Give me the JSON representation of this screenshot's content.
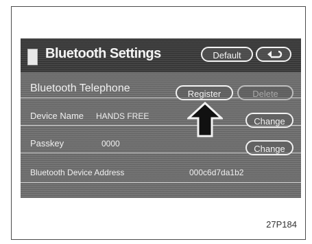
{
  "header": {
    "title": "Bluetooth Settings",
    "default_label": "Default",
    "back_icon": "return-arrow-icon"
  },
  "telephone": {
    "label": "Bluetooth Telephone",
    "register_label": "Register",
    "delete_label": "Delete"
  },
  "device_name": {
    "label": "Device Name",
    "value": "HANDS FREE",
    "change_label": "Change"
  },
  "passkey": {
    "label": "Passkey",
    "value": "0000",
    "change_label": "Change"
  },
  "address": {
    "label": "Bluetooth Device Address",
    "value": "000c6d7da1b2"
  },
  "figure_code": "27P184",
  "colors": {
    "screen_bg": "#6f6f6f",
    "header_bg": "#3a3a3a",
    "text": "#f4f4f4"
  }
}
